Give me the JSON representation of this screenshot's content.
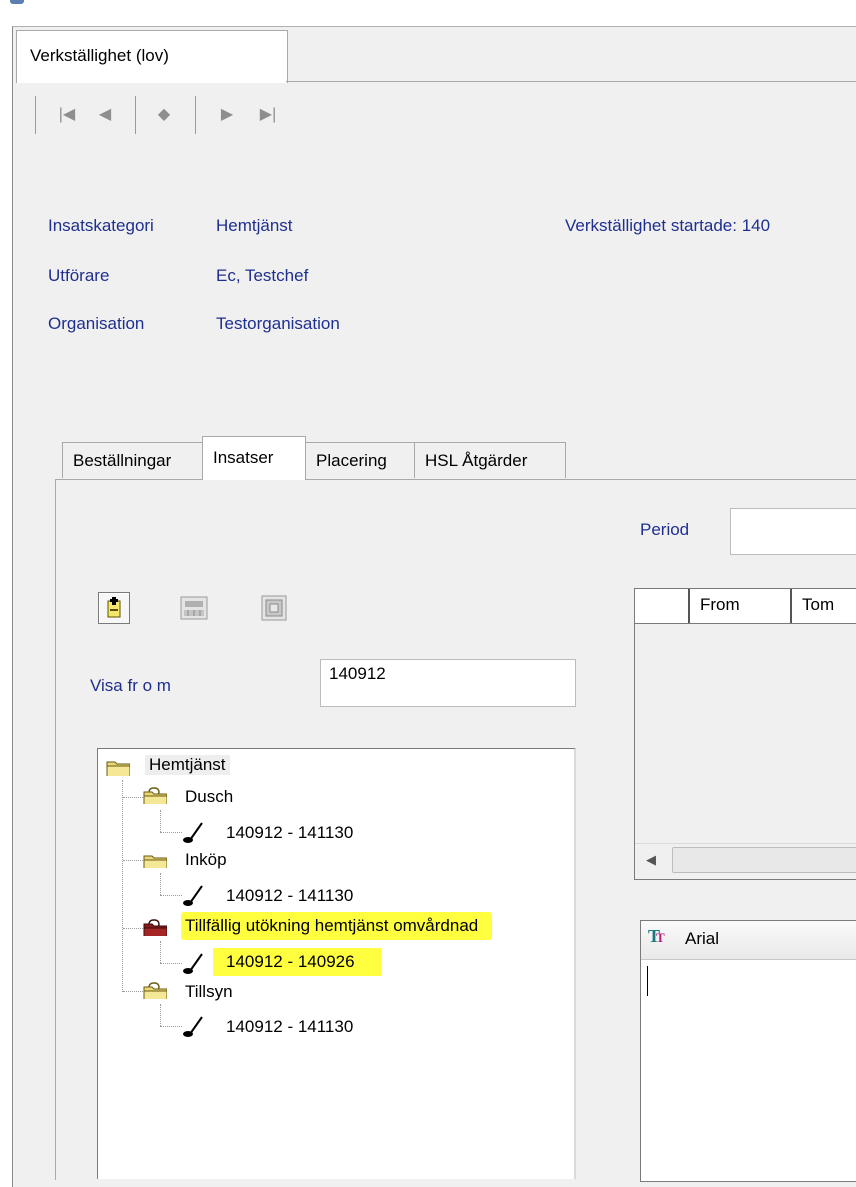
{
  "window": {
    "tab_title": "Verkställighet (lov)"
  },
  "navigation": {
    "buttons": [
      {
        "name": "first",
        "glyph": "|◀"
      },
      {
        "name": "prev",
        "glyph": "◀"
      },
      {
        "name": "current",
        "glyph": "◆"
      },
      {
        "name": "next",
        "glyph": "▶"
      },
      {
        "name": "last",
        "glyph": "▶|"
      }
    ]
  },
  "info": {
    "insatskategori_label": "Insatskategori",
    "insatskategori_value": "Hemtjänst",
    "utforare_label": "Utförare",
    "utforare_value": "Ec, Testchef",
    "organisation_label": "Organisation",
    "organisation_value": "Testorganisation",
    "started_text": "Verkställighet startade: 140"
  },
  "subtabs": [
    {
      "label": "Beställningar",
      "active": false
    },
    {
      "label": "Insatser",
      "active": true
    },
    {
      "label": "Placering",
      "active": false
    },
    {
      "label": "HSL Åtgärder",
      "active": false
    }
  ],
  "period": {
    "label": "Period",
    "value": ""
  },
  "toolbar": {
    "icons": [
      "add-icon",
      "keyboard-icon",
      "copy-icon"
    ]
  },
  "visa": {
    "label": "Visa fr o m",
    "value": "140912"
  },
  "tree": {
    "root": "Hemtjänst",
    "items": [
      {
        "label": "Dusch",
        "range": "140912 - 141130",
        "highlighted": false,
        "folder_color": "#e8d87a"
      },
      {
        "label": "Inköp",
        "range": "140912 - 141130",
        "highlighted": false,
        "folder_color": "#e8d87a"
      },
      {
        "label": "Tillfällig utökning hemtjänst omvårdnad",
        "range": "140912 - 140926",
        "highlighted": true,
        "folder_color": "#8a1a1a"
      },
      {
        "label": "Tillsyn",
        "range": "140912 - 141130",
        "highlighted": false,
        "folder_color": "#e8d87a"
      }
    ]
  },
  "grid": {
    "columns": [
      "",
      "From",
      "Tom"
    ]
  },
  "editor": {
    "font_name": "Arial",
    "font_icon": "truetype-icon"
  },
  "colors": {
    "label_blue": "#1f2f8f",
    "highlight": "#ffff40",
    "panel": "#f0f0f0"
  }
}
